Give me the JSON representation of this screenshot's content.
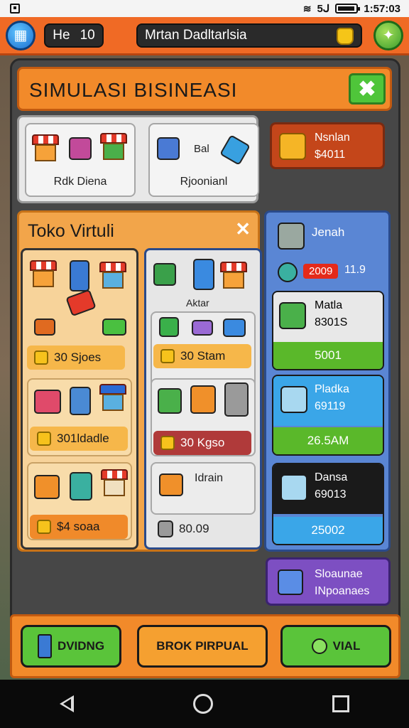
{
  "status_bar": {
    "time": "1:57:03",
    "carrier": "5ᒍ",
    "battery_fill": 0.8
  },
  "top_bar": {
    "level_label": "He",
    "level_value": "10",
    "title": "Mrtan Dadltarlsia"
  },
  "header": {
    "title": "SIMULASI BISINEASI"
  },
  "cards": [
    {
      "label": "Rdk Diena"
    },
    {
      "label": "Rjoonianl",
      "sub": "Bal"
    }
  ],
  "money": {
    "line1": "Nsnlan",
    "line2": "$4011"
  },
  "toko": {
    "title": "Toko Virtuli",
    "left_items": [
      {
        "price": "30 Sjoes"
      },
      {
        "price": "301ldadle"
      },
      {
        "price": "$4 soaa"
      }
    ],
    "right_items": [
      {
        "label": "Aktar"
      },
      {
        "price": "30 Stam"
      },
      {
        "price": "30 Kgso"
      },
      {
        "label": "Idrain",
        "price": "80.09"
      }
    ]
  },
  "side": {
    "title": "Jenah",
    "badge": "2009",
    "count": "11.9",
    "items": [
      {
        "name": "Matla",
        "value": "8301S",
        "price": "5001"
      },
      {
        "name": "Pladka",
        "value": "69119",
        "price": "26.5AM"
      },
      {
        "name": "Dansa",
        "value": "69013",
        "price": "25002"
      }
    ]
  },
  "purple_panel": {
    "line1": "Sloaunae",
    "line2": "INpoanaes"
  },
  "bottom": {
    "left": "DVIDNG",
    "middle": "BROK PIRPUAL",
    "right": "VIAL"
  },
  "colors": {
    "accent": "#f06a25",
    "panel": "#474747",
    "green": "#4fc53a",
    "blue": "#5a86d4"
  }
}
